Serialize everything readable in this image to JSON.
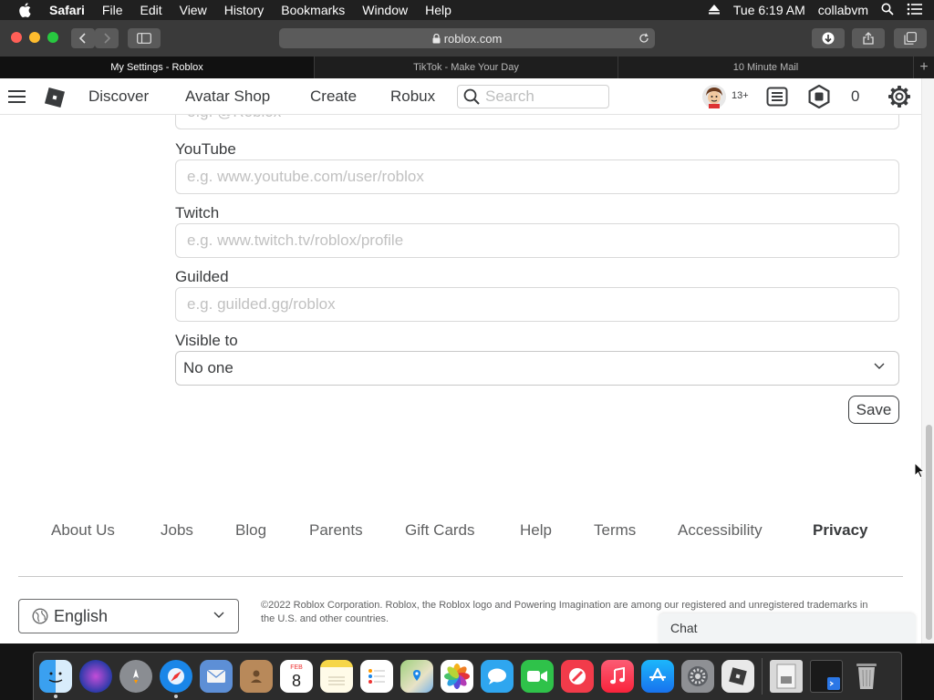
{
  "menubar": {
    "app": "Safari",
    "items": [
      "File",
      "Edit",
      "View",
      "History",
      "Bookmarks",
      "Window",
      "Help"
    ],
    "clock": "Tue 6:19 AM",
    "user": "collabvm"
  },
  "browser": {
    "url": "roblox.com",
    "tabs": [
      {
        "title": "My Settings - Roblox"
      },
      {
        "title": "TikTok - Make Your Day"
      },
      {
        "title": "10 Minute Mail"
      }
    ]
  },
  "header": {
    "nav": [
      "Discover",
      "Avatar Shop",
      "Create",
      "Robux"
    ],
    "search_placeholder": "Search",
    "age_badge": "13+",
    "robux_count": "0"
  },
  "form": {
    "partial_placeholder": "e.g. @Roblox",
    "youtube_label": "YouTube",
    "youtube_placeholder": "e.g. www.youtube.com/user/roblox",
    "twitch_label": "Twitch",
    "twitch_placeholder": "e.g. www.twitch.tv/roblox/profile",
    "guilded_label": "Guilded",
    "guilded_placeholder": "e.g. guilded.gg/roblox",
    "visible_label": "Visible to",
    "visible_value": "No one",
    "save_label": "Save"
  },
  "footer": {
    "links": [
      "About Us",
      "Jobs",
      "Blog",
      "Parents",
      "Gift Cards",
      "Help",
      "Terms",
      "Accessibility",
      "Privacy"
    ],
    "language": "English",
    "copyright": "©2022 Roblox Corporation. Roblox, the Roblox logo and Powering Imagination are among our registered and unregistered trademarks in the U.S. and other countries."
  },
  "chat": {
    "label": "Chat"
  },
  "dock": {
    "apps": [
      "finder",
      "siri",
      "launchpad",
      "safari",
      "mail",
      "contacts",
      "calendar",
      "notes",
      "reminders",
      "maps",
      "photos",
      "messages",
      "facetime",
      "news",
      "music",
      "app-store",
      "system-preferences",
      "roblox",
      "preview",
      "terminal",
      "trash"
    ],
    "calendar_month": "FEB",
    "calendar_day": "8"
  }
}
